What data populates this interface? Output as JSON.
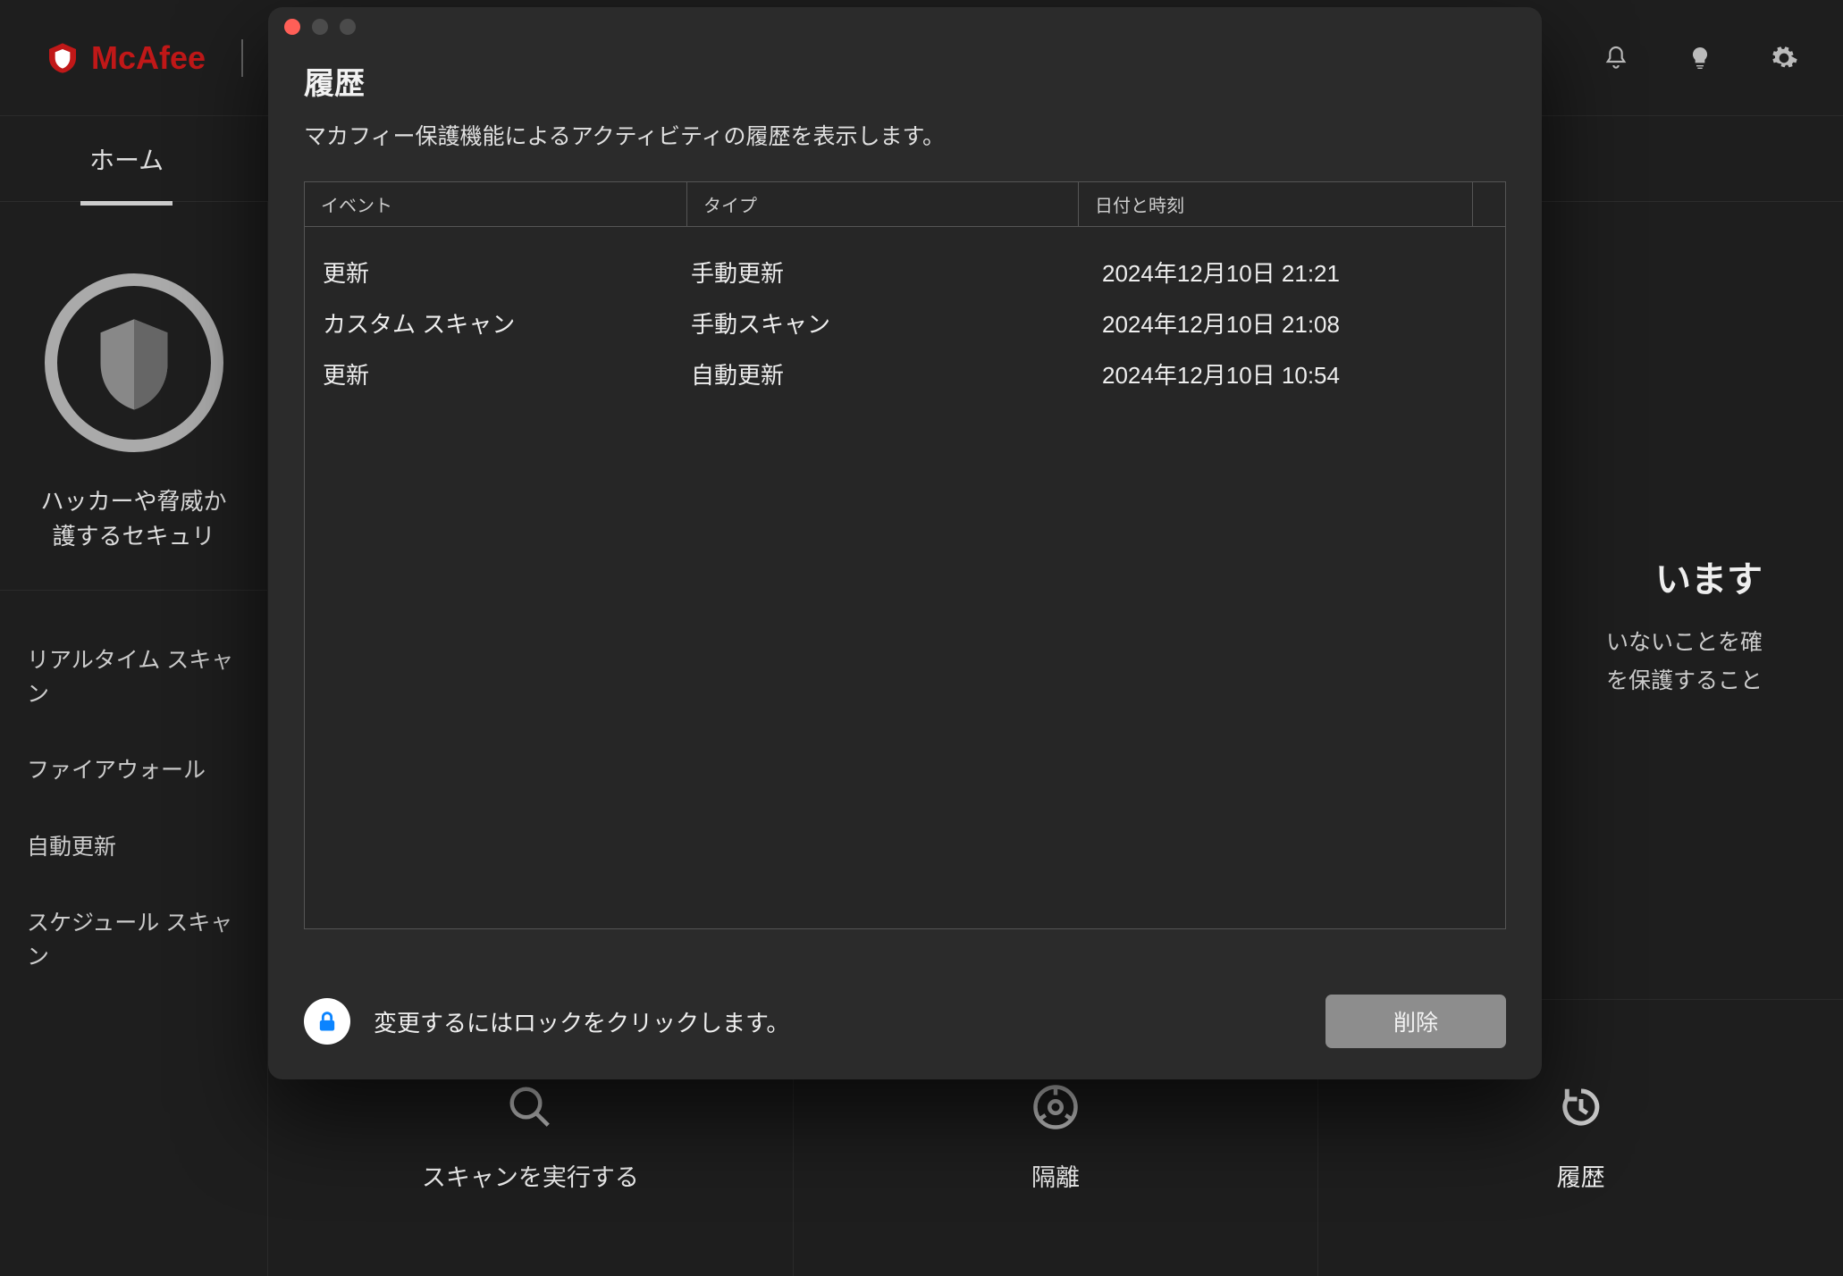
{
  "brand": "McAfee",
  "nav": {
    "home": "ホーム"
  },
  "header_icons": {
    "bell": "bell-icon",
    "idea": "lightbulb-icon",
    "gear": "gear-icon"
  },
  "sidebar": {
    "shield_text_line1": "ハッカーや脅威か",
    "shield_text_line2": "護するセキュリ",
    "items": [
      {
        "label": "リアルタイム スキャン"
      },
      {
        "label": "ファイアウォール"
      },
      {
        "label": "自動更新"
      },
      {
        "label": "スケジュール スキャン"
      }
    ]
  },
  "main_status": {
    "title_fragment": "います",
    "desc_line1": "いないことを確",
    "desc_line2": "を保護すること"
  },
  "actions": {
    "scan": "スキャンを実行する",
    "quarantine": "隔離",
    "history": "履歴"
  },
  "dialog": {
    "title": "履歴",
    "subtitle": "マカフィー保護機能によるアクティビティの履歴を表示します。",
    "columns": {
      "event": "イベント",
      "type": "タイプ",
      "date": "日付と時刻"
    },
    "rows": [
      {
        "event": "更新",
        "type": "手動更新",
        "date": "2024年12月10日 21:21"
      },
      {
        "event": "カスタム スキャン",
        "type": "手動スキャン",
        "date": "2024年12月10日 21:08"
      },
      {
        "event": "更新",
        "type": "自動更新",
        "date": "2024年12月10日 10:54"
      }
    ],
    "lock_text": "変更するにはロックをクリックします。",
    "delete": "削除"
  }
}
